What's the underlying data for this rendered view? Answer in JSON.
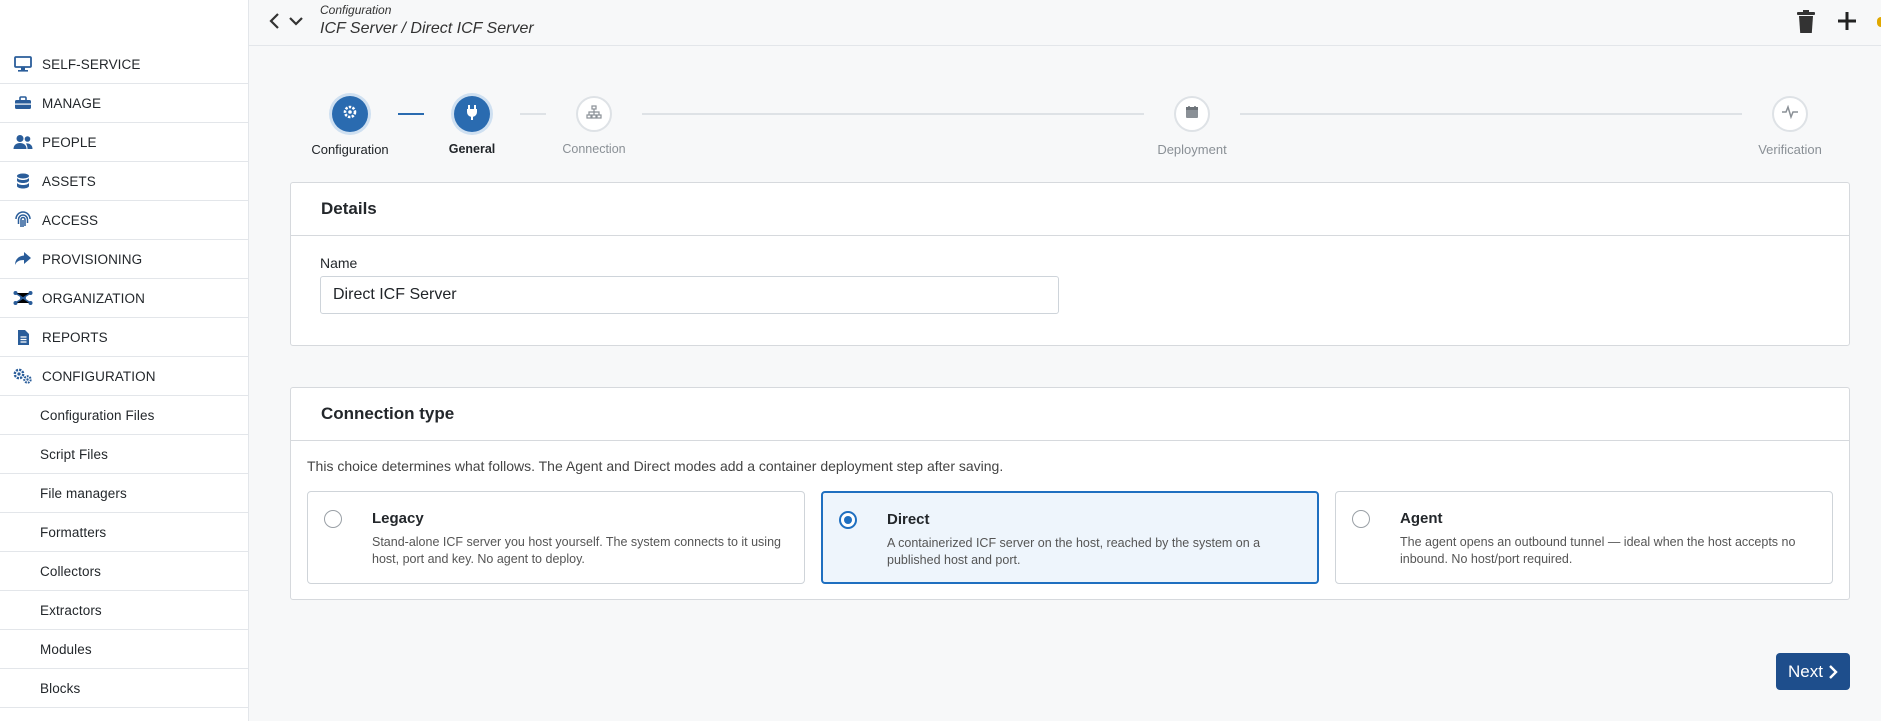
{
  "header": {
    "breadcrumb_top": "Configuration",
    "breadcrumb_main": "ICF Server / Direct ICF Server"
  },
  "sidebar": {
    "items": [
      {
        "label": "SELF-SERVICE",
        "icon": "monitor-icon"
      },
      {
        "label": "MANAGE",
        "icon": "toolbox-icon"
      },
      {
        "label": "PEOPLE",
        "icon": "users-icon"
      },
      {
        "label": "ASSETS",
        "icon": "database-icon"
      },
      {
        "label": "ACCESS",
        "icon": "fingerprint-icon"
      },
      {
        "label": "PROVISIONING",
        "icon": "share-arrow-icon"
      },
      {
        "label": "ORGANIZATION",
        "icon": "network-icon"
      },
      {
        "label": "REPORTS",
        "icon": "file-icon"
      },
      {
        "label": "CONFIGURATION",
        "icon": "gears-icon"
      }
    ],
    "sub_items": [
      "Configuration Files",
      "Script Files",
      "File managers",
      "Formatters",
      "Collectors",
      "Extractors",
      "Modules",
      "Blocks"
    ]
  },
  "stepper": {
    "steps": [
      {
        "label": "Configuration",
        "state": "completed",
        "icon": "gear-icon"
      },
      {
        "label": "General",
        "state": "active",
        "icon": "plug-icon"
      },
      {
        "label": "Connection",
        "state": "inactive",
        "icon": "sitemap-icon"
      },
      {
        "label": "Deployment",
        "state": "inactive",
        "icon": "calendar-icon"
      },
      {
        "label": "Verification",
        "state": "inactive",
        "icon": "heartbeat-icon"
      }
    ]
  },
  "details": {
    "title": "Details",
    "name_label": "Name",
    "name_value": "Direct ICF Server"
  },
  "connection": {
    "title": "Connection type",
    "description": "This choice determines what follows. The Agent and Direct modes add a container deployment step after saving.",
    "options": [
      {
        "title": "Legacy",
        "description": "Stand-alone ICF server you host yourself. The system connects to it using host, port and key. No agent to deploy.",
        "selected": false
      },
      {
        "title": "Direct",
        "description": "A containerized ICF server on the host, reached by the system on a published host and port.",
        "selected": true
      },
      {
        "title": "Agent",
        "description": "The agent opens an outbound tunnel — ideal when the host accepts no inbound. No host/port required.",
        "selected": false
      }
    ]
  },
  "actions": {
    "next_label": "Next"
  },
  "colors": {
    "accent": "#2a6bb0",
    "next_button": "#1e4e8c",
    "selected_border": "#1f6fc0",
    "sidebar_icon": "#2a5d9a"
  }
}
